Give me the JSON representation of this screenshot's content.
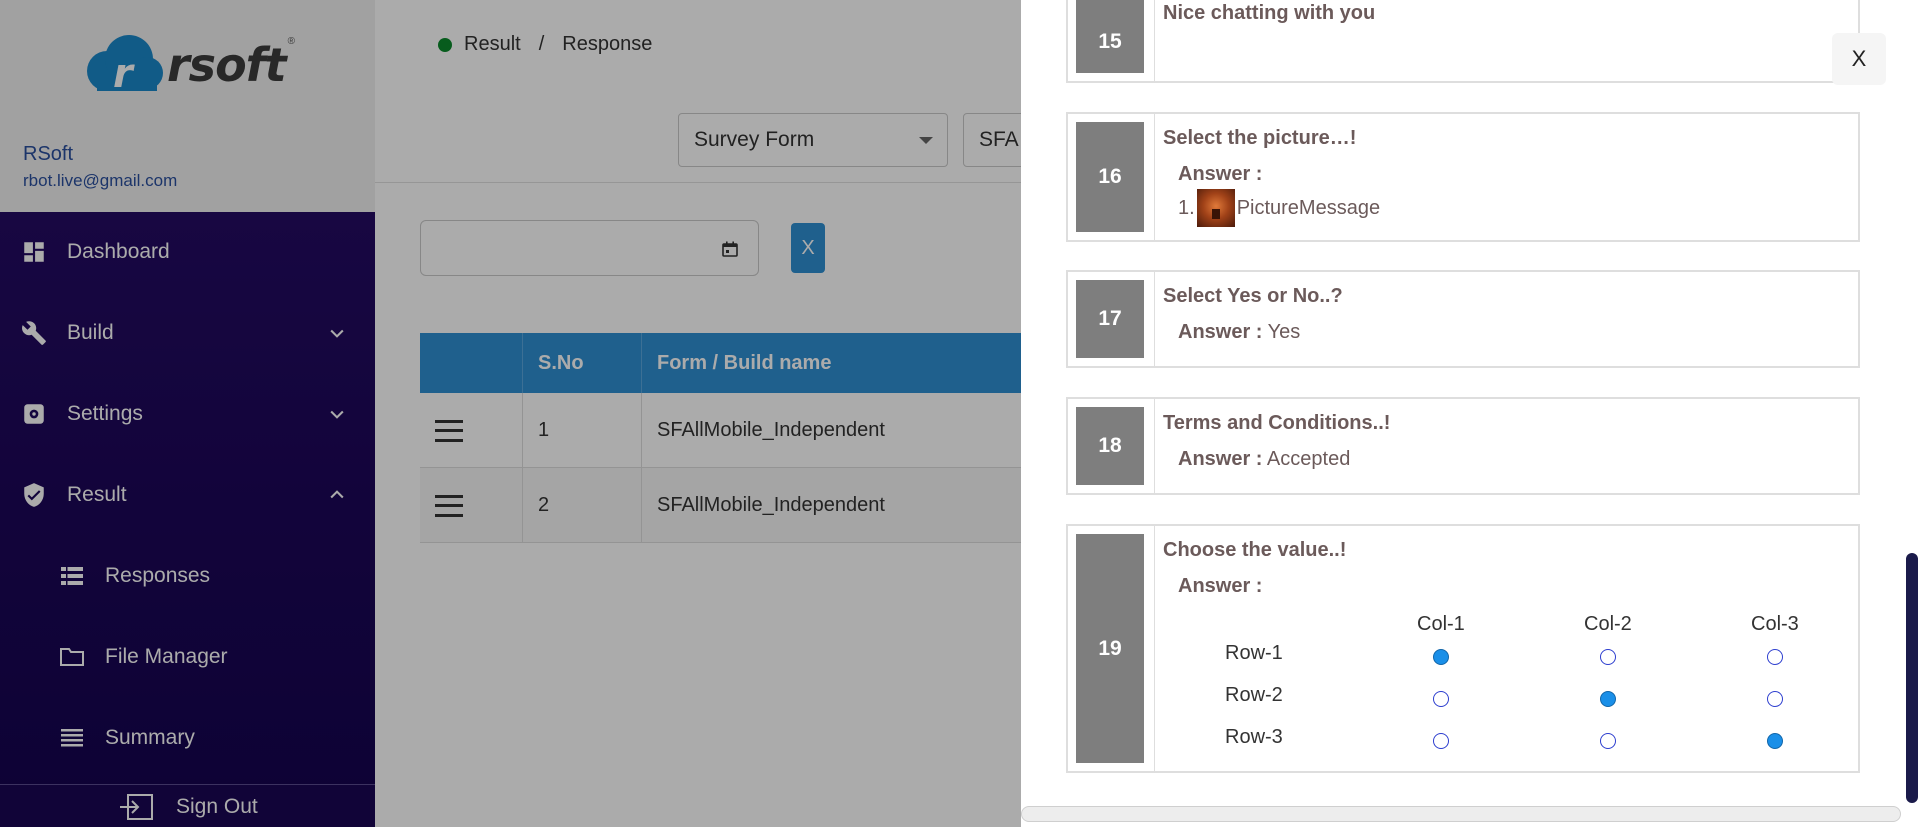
{
  "brand": {
    "logo_text": "rsoft",
    "reg_mark": "®"
  },
  "user": {
    "name": "RSoft",
    "email": "rbot.live@gmail.com"
  },
  "sidebar": {
    "items": [
      {
        "label": "Dashboard",
        "icon": "dashboard-icon"
      },
      {
        "label": "Build",
        "icon": "wrench-icon",
        "expandable": true,
        "expanded": false
      },
      {
        "label": "Settings",
        "icon": "settings-icon",
        "expandable": true,
        "expanded": false
      },
      {
        "label": "Result",
        "icon": "shield-check-icon",
        "expandable": true,
        "expanded": true
      },
      {
        "label": "Responses",
        "icon": "list-icon"
      },
      {
        "label": "File Manager",
        "icon": "folder-icon"
      },
      {
        "label": "Summary",
        "icon": "lines-icon"
      }
    ],
    "signout": "Sign Out"
  },
  "breadcrumb": {
    "first": "Result",
    "separator": "/",
    "second": "Response"
  },
  "filters": {
    "form_type": "Survey Form",
    "form_name": "SFA"
  },
  "date_clear": "X",
  "table": {
    "headers": [
      "",
      "S.No",
      "Form / Build name"
    ],
    "rows": [
      {
        "sno": "1",
        "name": "SFAllMobile_Independent"
      },
      {
        "sno": "2",
        "name": "SFAllMobile_Independent"
      }
    ]
  },
  "modal": {
    "close_label": "X",
    "answer_label": "Answer :",
    "questions": [
      {
        "num": "15",
        "title": "Nice chatting with you"
      },
      {
        "num": "16",
        "title": "Select the picture…!",
        "answer_index": "1.",
        "answer_text": "PictureMessage"
      },
      {
        "num": "17",
        "title": "Select Yes or No..?",
        "answer": "Yes"
      },
      {
        "num": "18",
        "title": "Terms and Conditions..!",
        "answer": "Accepted"
      },
      {
        "num": "19",
        "title": "Choose the value..!",
        "grid": {
          "columns": [
            "Col-1",
            "Col-2",
            "Col-3"
          ],
          "rows": [
            "Row-1",
            "Row-2",
            "Row-3"
          ],
          "selected": [
            1,
            2,
            3
          ]
        }
      }
    ]
  }
}
